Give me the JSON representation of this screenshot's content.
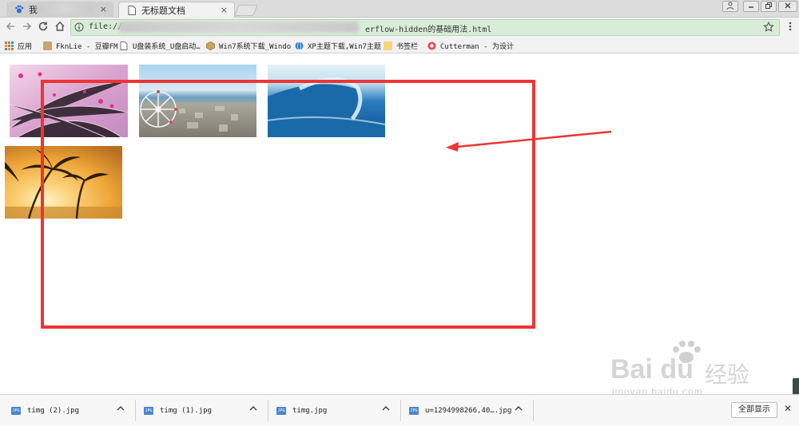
{
  "browser": {
    "tabs": [
      {
        "label": "我",
        "active": false
      },
      {
        "label": "无标题文档",
        "active": true
      }
    ],
    "tab_close_glyph": "×",
    "window_controls": [
      "user-icon",
      "minimize-icon",
      "restore-icon",
      "close-icon"
    ],
    "address": {
      "prefix": "file://",
      "suffix": "erflow-hidden的基础用法.html",
      "secure_icon": "info-icon"
    },
    "bookmarks": [
      {
        "label": "应用",
        "icon": "apps-grid-icon"
      },
      {
        "label": "FknLie - 豆瓣FM",
        "icon": "folder-icon"
      },
      {
        "label": "U盘装系统_U盘启动…",
        "icon": "page-icon"
      },
      {
        "label": "Win7系统下载_Windo",
        "icon": "cube-icon"
      },
      {
        "label": "XP主题下载,Win7主题",
        "icon": "globe-icon"
      },
      {
        "label": "书签栏",
        "icon": "folder-icon"
      },
      {
        "label": "Cutterman - 为设计",
        "icon": "cutterman-icon"
      }
    ]
  },
  "page": {
    "images": [
      {
        "name": "flowers-image",
        "colors": [
          "#e8b9d8",
          "#c98fc4",
          "#f4d8ea"
        ]
      },
      {
        "name": "ferris-wheel-image",
        "colors": [
          "#bcdcf0",
          "#8fa9b8",
          "#d9d4c4"
        ]
      },
      {
        "name": "wave-image",
        "colors": [
          "#2b7ec0",
          "#0d4f8e",
          "#dfeef7"
        ]
      },
      {
        "name": "palm-sunset-image",
        "colors": [
          "#f5b13c",
          "#7a4a12",
          "#fde6a8"
        ]
      }
    ],
    "annotation_color": "#ee3434"
  },
  "watermark": {
    "brand": "Bai du",
    "chinese": "经验",
    "url": "jingyan.baidu.com"
  },
  "downloads": {
    "items": [
      {
        "filename": "timg (2).jpg"
      },
      {
        "filename": "timg (1).jpg"
      },
      {
        "filename": "timg.jpg"
      },
      {
        "filename": "u=1294998266,40….jpg"
      }
    ],
    "icon_badge": "JPG",
    "show_all_label": "全部显示",
    "close_glyph": "✕"
  }
}
